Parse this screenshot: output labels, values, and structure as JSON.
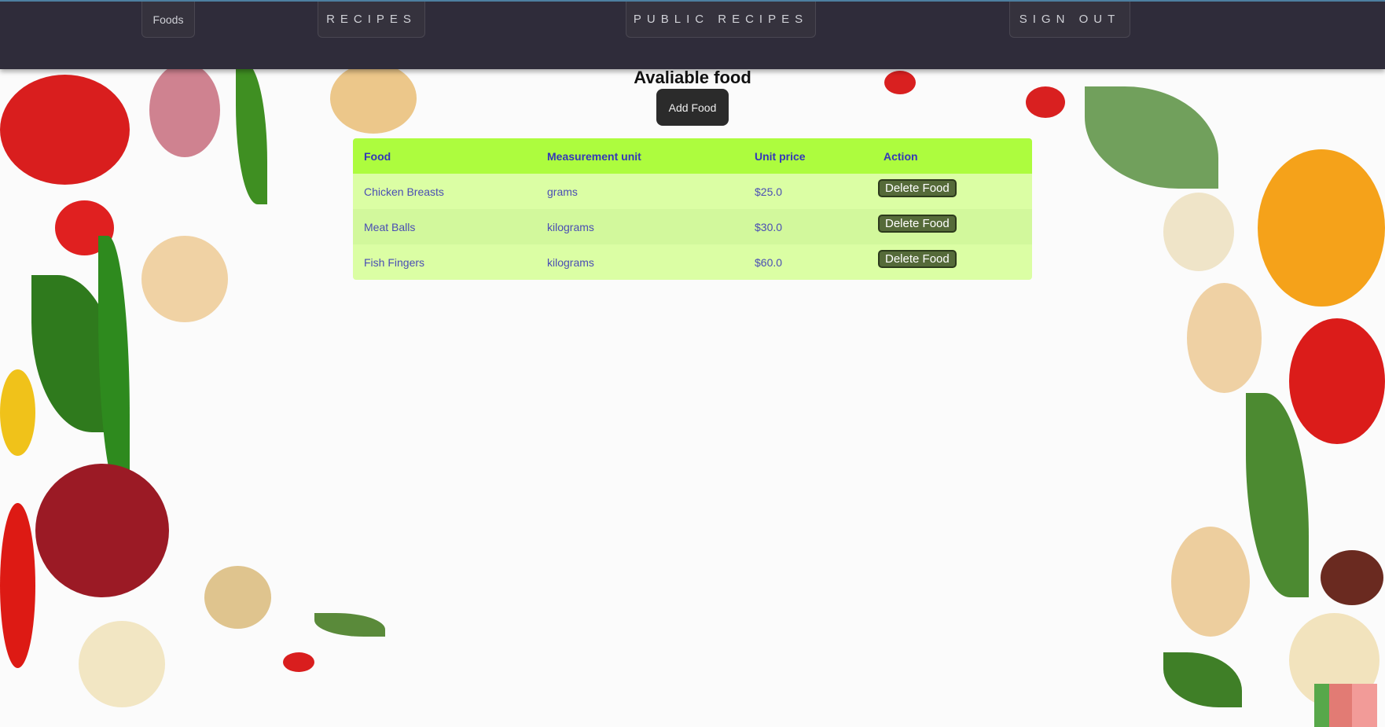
{
  "nav": {
    "foods_label": "Foods",
    "recipes_label": "RECIPES",
    "public_recipes_label": "PUBLIC RECIPES",
    "sign_out_label": "SIGN OUT"
  },
  "main": {
    "title": "Avaliable food",
    "add_button_label": "Add Food"
  },
  "table": {
    "headers": [
      "Food",
      "Measurement unit",
      "Unit price",
      "Action"
    ],
    "rows": [
      {
        "food": "Chicken Breasts",
        "unit": "grams",
        "price": "$25.0",
        "action": "Delete Food"
      },
      {
        "food": "Meat Balls",
        "unit": "kilograms",
        "price": "$30.0",
        "action": "Delete Food"
      },
      {
        "food": "Fish Fingers",
        "unit": "kilograms",
        "price": "$60.0",
        "action": "Delete Food"
      }
    ]
  },
  "colors": {
    "navbar": "#2f2c3a",
    "table_header": "#adfc3e",
    "table_row": "#dbfea4",
    "table_text": "#4a4db4",
    "delete_button": "#556a39"
  },
  "background": "food-ingredients-image"
}
